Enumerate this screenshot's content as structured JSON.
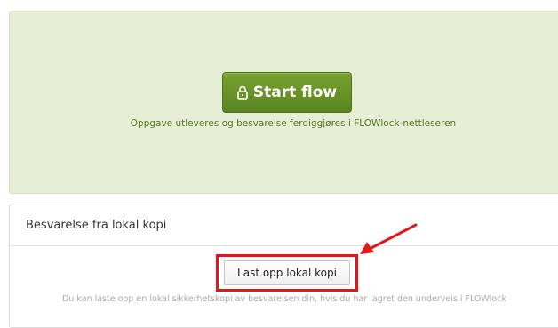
{
  "flow": {
    "start_label": "Start flow",
    "start_icon": "lock-icon",
    "description": "Oppgave utleveres og besvarelse ferdiggjøres i FLOWlock-nettleseren"
  },
  "local_copy": {
    "heading": "Besvarelse fra lokal kopi",
    "upload_label": "Last opp lokal kopi",
    "description": "Du kan laste opp en lokal sikkerhetskopi av besvarelsen din, hvis du har lagret den underveis i FLOWlock"
  },
  "annotation": {
    "highlight_color": "#e3161b",
    "arrow_icon": "arrow-icon"
  },
  "colors": {
    "accent_green": "#67922a",
    "panel_bg": "#e6eed6"
  }
}
